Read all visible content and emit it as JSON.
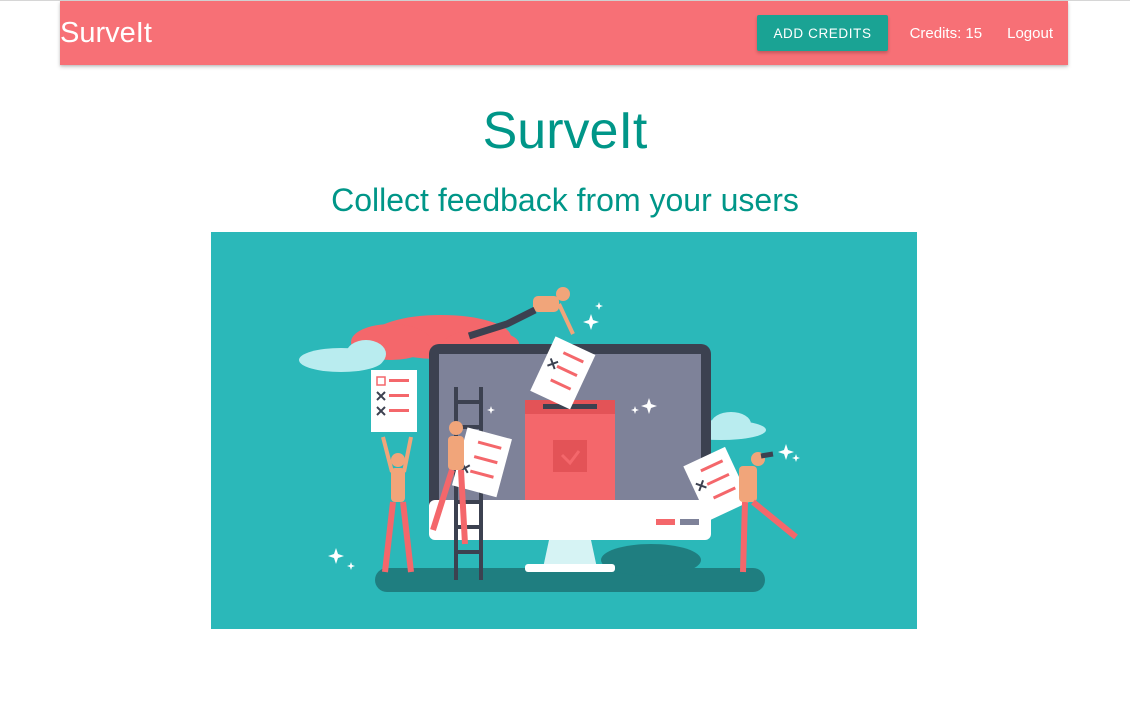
{
  "navbar": {
    "brand": "SurveIt",
    "add_credits_label": "ADD CREDITS",
    "credits_text": "Credits: 15",
    "logout_label": "Logout"
  },
  "hero": {
    "title": "SurveIt",
    "subtitle": "Collect feedback from your users"
  },
  "colors": {
    "navbar_bg": "#f77076",
    "accent_teal": "#009688",
    "button_teal": "#1aa394",
    "illustration_bg": "#2bb8b9"
  }
}
